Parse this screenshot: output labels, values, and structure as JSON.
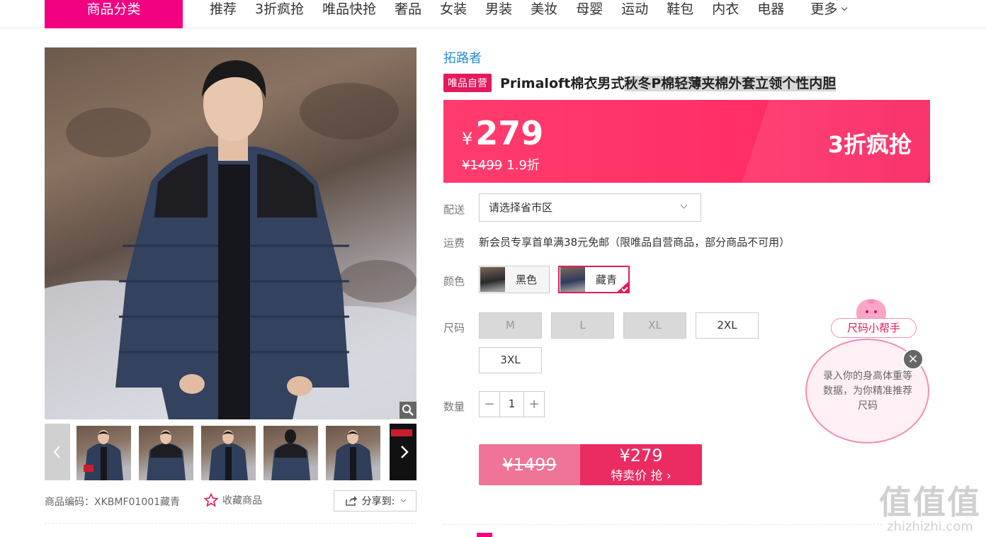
{
  "topnav": {
    "category_button": "商品分类",
    "items": [
      "推荐",
      "3折疯抢",
      "唯品快抢",
      "奢品",
      "女装",
      "男装",
      "美妆",
      "母婴",
      "运动",
      "鞋包",
      "内衣",
      "电器"
    ],
    "more": "更多"
  },
  "gallery": {
    "thumbnail_count": 6,
    "product_code_label": "商品编码：",
    "product_code": "XKBMF01001藏青",
    "favorite_label": "收藏商品",
    "share_label": "分享到:"
  },
  "product": {
    "brand": "拓路者",
    "self_operated_badge": "唯品自营",
    "title_main": "Primaloft棉衣男式",
    "title_highlight": "秋冬P棉轻薄夹棉外套立领个性内胆"
  },
  "price_banner": {
    "currency": "¥",
    "price": "279",
    "original_price": "¥1499",
    "discount": "1.9折",
    "promo": "3折疯抢"
  },
  "delivery": {
    "label": "配送",
    "placeholder": "请选择省市区"
  },
  "shipping": {
    "label": "运费",
    "text": "新会员专享首单满38元免邮（限唯品自营商品，部分商品不可用）"
  },
  "colors": {
    "label": "颜色",
    "options": [
      {
        "name": "黑色",
        "selected": false
      },
      {
        "name": "藏青",
        "selected": true
      }
    ]
  },
  "sizes": {
    "label": "尺码",
    "options": [
      {
        "name": "M",
        "available": false
      },
      {
        "name": "L",
        "available": false
      },
      {
        "name": "XL",
        "available": false
      },
      {
        "name": "2XL",
        "available": true
      },
      {
        "name": "3XL",
        "available": true
      }
    ]
  },
  "quantity": {
    "label": "数量",
    "value": "1",
    "minus": "−",
    "plus": "+"
  },
  "buy_button": {
    "original": "¥1499",
    "price": "¥279",
    "action": "特卖价 抢 ›"
  },
  "size_helper": {
    "tag": "尺码小帮手",
    "text": "录入你的身高体重等数据，为你精准推荐尺码",
    "close": "×"
  },
  "watermark": {
    "big": "值值值",
    "small": "zhizhizhi.com"
  },
  "colors_theme": {
    "brand_pink": "#f10180",
    "price_red": "#ff2f66",
    "link_blue": "#2a8bd3"
  }
}
